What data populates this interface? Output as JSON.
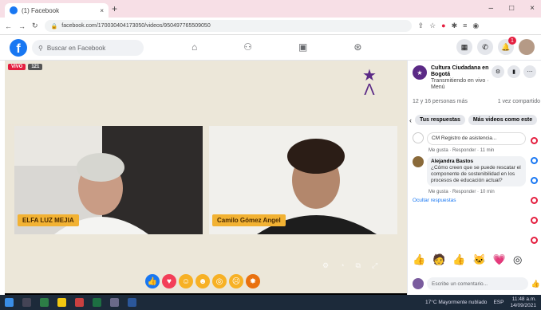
{
  "browser": {
    "tab_title": "(1) Facebook",
    "tab_close": "×",
    "new_tab": "+",
    "url": "facebook.com/170030404173050/videos/950497765509050",
    "win_min": "‒",
    "win_max": "□",
    "win_close": "×"
  },
  "facebook": {
    "logo": "f",
    "search_placeholder": "Buscar en Facebook",
    "notification_count": "1"
  },
  "video": {
    "live_badge": "VIVO",
    "viewer_badge": "121",
    "participants": [
      {
        "name": "ELFA LUZ MEJIA"
      },
      {
        "name": "Camilo Gómez Angel"
      }
    ]
  },
  "panel": {
    "page_name": "Cultura Ciudadana en Bogotá",
    "page_sub": "Transmitiendo en vivo · Menú",
    "stats_left": "12 y 16 personas más",
    "stats_right": "1 vez compartido",
    "pill_1": "Tus respuestas",
    "pill_2": "Más videos como este",
    "comments": [
      {
        "author": "",
        "text": "CM Registro de asistencia...",
        "meta": "Me gusta · Responder · 11 min"
      },
      {
        "author": "Alejandra Bastos",
        "text": "¿Cómo creen que se puede rescatar el componente de sostenibilidad en los procesos de educación actual?",
        "meta": "Me gusta · Responder · 10 min"
      }
    ],
    "hide_replies": "Ocultar respuestas",
    "comment_placeholder": "Escribe un comentario..."
  },
  "taskbar": {
    "weather": "17°C Mayormente nublado",
    "lang": "ESP",
    "time": "11:48 a.m.",
    "date": "14/09/2021"
  }
}
